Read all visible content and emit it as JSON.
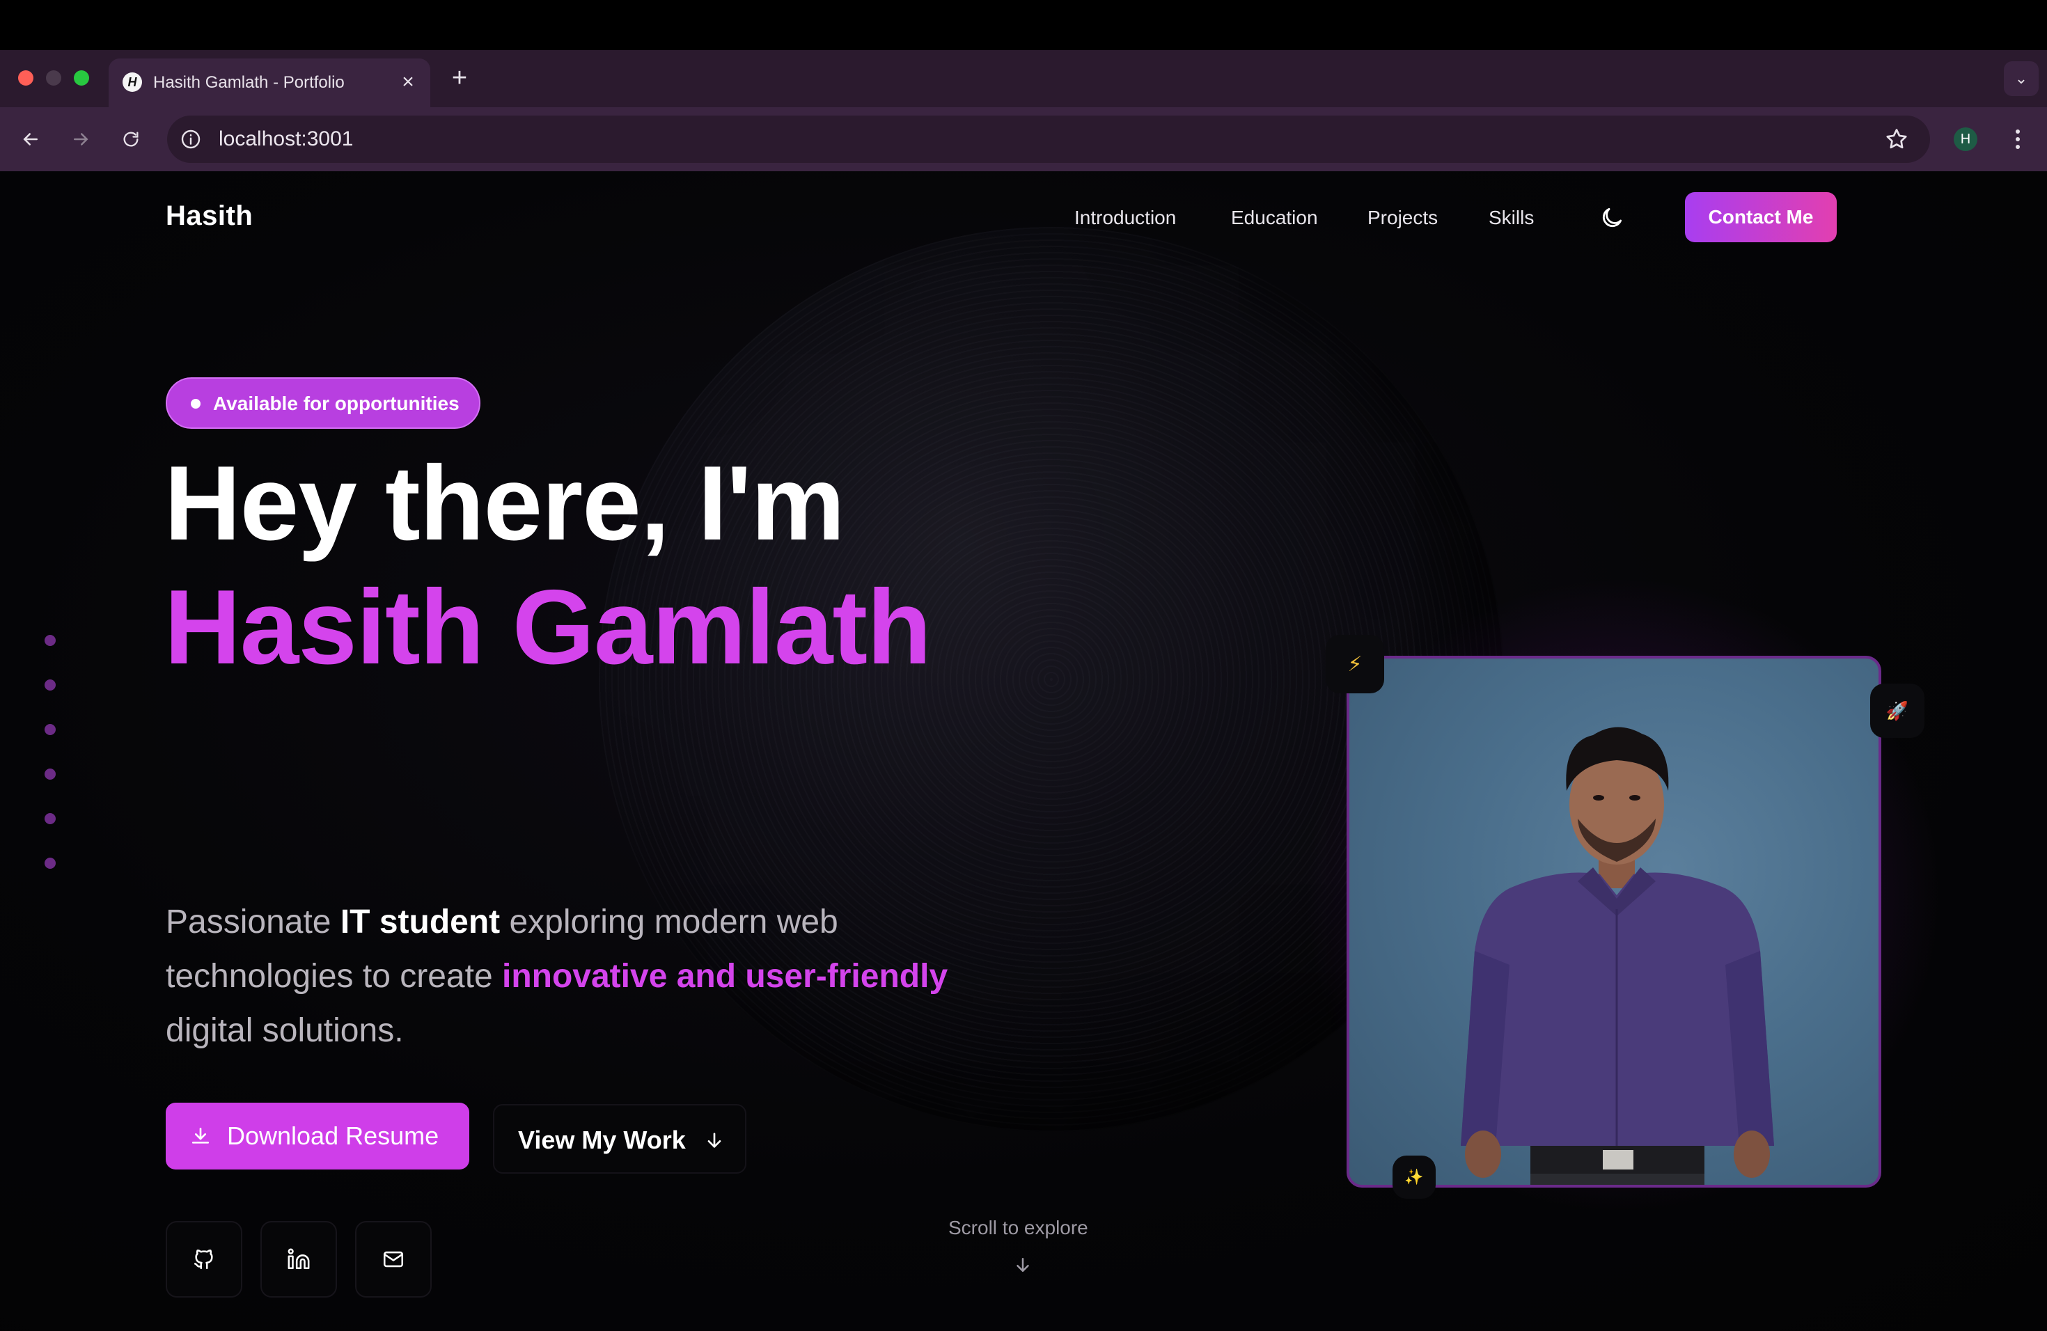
{
  "browser": {
    "tab_title": "Hasith Gamlath - Portfolio",
    "tab_favicon_letter": "H",
    "url": "localhost:3001",
    "profile_initial": "H"
  },
  "nav": {
    "brand": "Hasith",
    "links": [
      "Introduction",
      "Education",
      "Projects",
      "Skills"
    ],
    "contact_label": "Contact Me"
  },
  "hero": {
    "badge": "Available for opportunities",
    "heading_line1": "Hey there, I'm",
    "heading_line2": "Hasith Gamlath",
    "lead": {
      "p1": "Passionate ",
      "p2": "IT student",
      "p3": " exploring modern web technologies to create ",
      "p4": "innovative and user-friendly",
      "p5": " digital solutions."
    },
    "download_label": "Download Resume",
    "work_label": "View My Work",
    "scroll_label": "Scroll to explore"
  },
  "icons": {
    "bolt": "⚡",
    "rocket": "🚀",
    "sparkle": "✨"
  },
  "colors": {
    "accent": "#d444ec",
    "contact_gradient_start": "#a83ef0",
    "contact_gradient_end": "#e23fb0",
    "badge": "#b83fe0",
    "chrome": "#3a2440"
  }
}
